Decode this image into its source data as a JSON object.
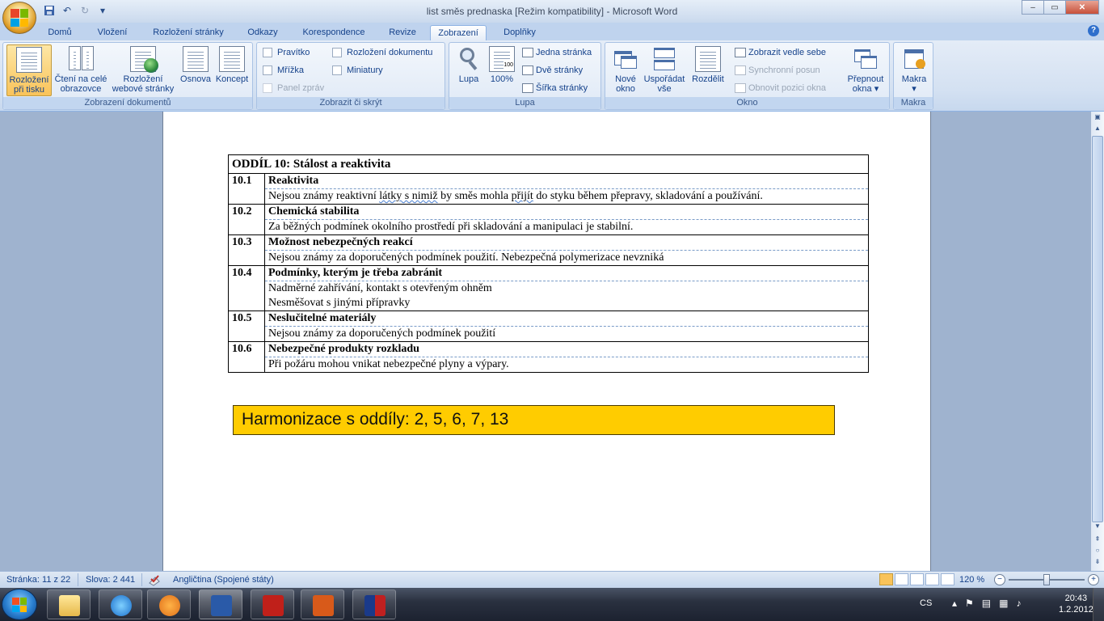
{
  "window": {
    "title": "list směs prednaska [Režim kompatibility] - Microsoft Word",
    "controls": {
      "minimize": "–",
      "maximize": "▭",
      "close": "✕"
    }
  },
  "qat": {
    "save_icon": "save-icon",
    "undo": "↶",
    "redo": "↻",
    "more": "▾"
  },
  "tabs": [
    "Domů",
    "Vložení",
    "Rozložení stránky",
    "Odkazy",
    "Korespondence",
    "Revize",
    "Zobrazení",
    "Doplňky"
  ],
  "active_tab": "Zobrazení",
  "ribbon": {
    "zobrazeni_dokumentu": {
      "label": "Zobrazení dokumentů",
      "buttons": [
        {
          "line1": "Rozložení",
          "line2": "při tisku"
        },
        {
          "line1": "Čtení na celé",
          "line2": "obrazovce"
        },
        {
          "line1": "Rozložení",
          "line2": "webové stránky"
        },
        {
          "line1": "Osnova",
          "line2": ""
        },
        {
          "line1": "Koncept",
          "line2": ""
        }
      ]
    },
    "zobrazit_skryt": {
      "label": "Zobrazit či skrýt",
      "checks": [
        "Pravítko",
        "Mřížka",
        "Panel zpráv",
        "Rozložení dokumentu",
        "Miniatury"
      ]
    },
    "lupa": {
      "label": "Lupa",
      "lupa_btn": "Lupa",
      "pct_btn": "100%",
      "jedna": "Jedna stránka",
      "dve": "Dvě stránky",
      "sirka": "Šířka stránky"
    },
    "okno": {
      "label": "Okno",
      "nove": {
        "line1": "Nové",
        "line2": "okno"
      },
      "usporadat": {
        "line1": "Uspořádat",
        "line2": "vše"
      },
      "rozdelit": "Rozdělit",
      "vedle": "Zobrazit vedle sebe",
      "synchronni": "Synchronní posun",
      "obnovit": "Obnovit pozici okna",
      "prepnout": {
        "line1": "Přepnout",
        "line2": "okna ▾"
      }
    },
    "makra": {
      "label": "Makra",
      "btn": "Makra",
      "arrow": "▾"
    }
  },
  "document": {
    "section_title": "ODDÍL 10: Stálost a reaktivita",
    "rows": [
      {
        "num": "10.1",
        "heading": "Reaktivita",
        "lines": [
          "Nejsou známy reaktivní látky s nimiž by směs mohla přijít do styku během přepravy, skladování a používání."
        ]
      },
      {
        "num": "10.2",
        "heading": "Chemická stabilita",
        "lines": [
          "Za běžných podmínek okolního prostředí při skladování a manipulaci je stabilní."
        ]
      },
      {
        "num": "10.3",
        "heading": "Možnost nebezpečných reakcí",
        "lines": [
          "Nejsou známy za doporučených podmínek použití. Nebezpečná polymerizace nevzniká"
        ]
      },
      {
        "num": "10.4",
        "heading": "Podmínky, kterým je třeba zabránit",
        "lines": [
          "Nadměrné zahřívání, kontakt s otevřeným ohněm",
          "Nesměšovat s jinými přípravky"
        ]
      },
      {
        "num": "10.5",
        "heading": "Neslučitelné materiály",
        "lines": [
          "Nejsou známy za doporučených podmínek použití"
        ]
      },
      {
        "num": "10.6",
        "heading": "Nebezpečné produkty rozkladu",
        "lines": [
          "Při požáru mohou vnikat nebezpečné plyny a výpary."
        ]
      }
    ],
    "harmonizace": "Harmonizace s oddíly: 2, 5, 6, 7, 13"
  },
  "status": {
    "page": "Stránka: 11 z 22",
    "words": "Slova: 2 441",
    "language": "Angličtina (Spojené státy)",
    "zoom": "120 %",
    "zoom_level": 0.5
  },
  "taskbar": {
    "lang": "CS",
    "time": "20:43",
    "date": "1.2.2012",
    "apps": [
      "explorer",
      "internet-explorer",
      "media-player",
      "word",
      "acrobat",
      "powerpoint",
      "other-app"
    ]
  },
  "colors": {
    "accent": "#15428b",
    "harmon_bg": "#ffcc00",
    "ribbon": "#dfe9f6"
  }
}
